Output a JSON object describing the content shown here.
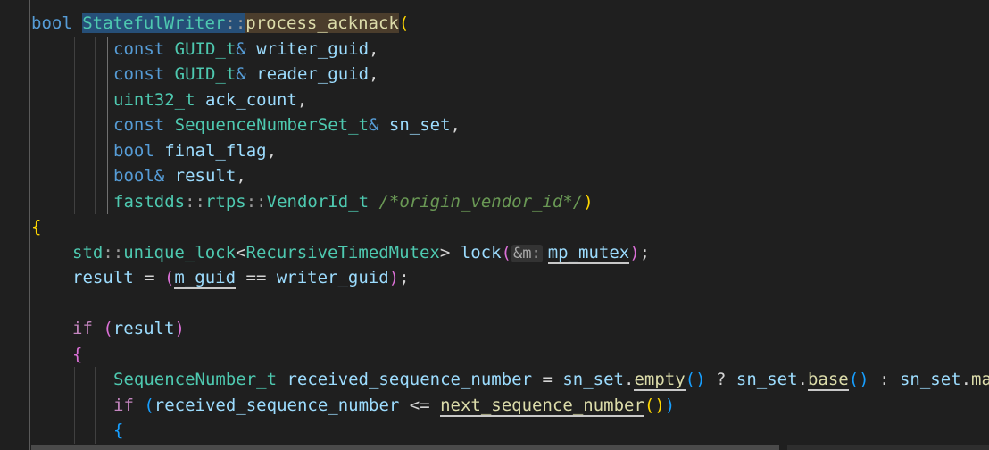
{
  "lines": [
    {
      "indent": 0,
      "tokens": [
        {
          "t": "bool",
          "c": "#569cd6"
        },
        {
          "t": " ",
          "c": "#d4d4d4"
        },
        {
          "t": "StatefulWriter",
          "c": "#4ec9b0",
          "hl": "sel"
        },
        {
          "t": "::",
          "c": "#9a9a9a",
          "hl": "sel"
        },
        {
          "t": "process_acknack",
          "c": "#dcdcaa",
          "hl": "hl"
        },
        {
          "t": "(",
          "c": "#ffd700"
        }
      ]
    },
    {
      "indent": 8,
      "tokens": [
        {
          "t": "const",
          "c": "#569cd6"
        },
        {
          "t": " ",
          "c": "#d4d4d4"
        },
        {
          "t": "GUID_t",
          "c": "#4ec9b0"
        },
        {
          "t": "&",
          "c": "#569cd6"
        },
        {
          "t": " ",
          "c": "#d4d4d4"
        },
        {
          "t": "writer_guid",
          "c": "#9cdcfe"
        },
        {
          "t": ",",
          "c": "#d4d4d4"
        }
      ]
    },
    {
      "indent": 8,
      "tokens": [
        {
          "t": "const",
          "c": "#569cd6"
        },
        {
          "t": " ",
          "c": "#d4d4d4"
        },
        {
          "t": "GUID_t",
          "c": "#4ec9b0"
        },
        {
          "t": "&",
          "c": "#569cd6"
        },
        {
          "t": " ",
          "c": "#d4d4d4"
        },
        {
          "t": "reader_guid",
          "c": "#9cdcfe"
        },
        {
          "t": ",",
          "c": "#d4d4d4"
        }
      ]
    },
    {
      "indent": 8,
      "tokens": [
        {
          "t": "uint32_t",
          "c": "#4ec9b0"
        },
        {
          "t": " ",
          "c": "#d4d4d4"
        },
        {
          "t": "ack_count",
          "c": "#9cdcfe"
        },
        {
          "t": ",",
          "c": "#d4d4d4"
        }
      ]
    },
    {
      "indent": 8,
      "tokens": [
        {
          "t": "const",
          "c": "#569cd6"
        },
        {
          "t": " ",
          "c": "#d4d4d4"
        },
        {
          "t": "SequenceNumberSet_t",
          "c": "#4ec9b0"
        },
        {
          "t": "&",
          "c": "#569cd6"
        },
        {
          "t": " ",
          "c": "#d4d4d4"
        },
        {
          "t": "sn_set",
          "c": "#9cdcfe"
        },
        {
          "t": ",",
          "c": "#d4d4d4"
        }
      ]
    },
    {
      "indent": 8,
      "tokens": [
        {
          "t": "bool",
          "c": "#569cd6"
        },
        {
          "t": " ",
          "c": "#d4d4d4"
        },
        {
          "t": "final_flag",
          "c": "#9cdcfe"
        },
        {
          "t": ",",
          "c": "#d4d4d4"
        }
      ]
    },
    {
      "indent": 8,
      "tokens": [
        {
          "t": "bool",
          "c": "#569cd6"
        },
        {
          "t": "&",
          "c": "#569cd6"
        },
        {
          "t": " ",
          "c": "#d4d4d4"
        },
        {
          "t": "result",
          "c": "#9cdcfe"
        },
        {
          "t": ",",
          "c": "#d4d4d4"
        }
      ]
    },
    {
      "indent": 8,
      "tokens": [
        {
          "t": "fastdds",
          "c": "#4ec9b0"
        },
        {
          "t": "::",
          "c": "#9a9a9a"
        },
        {
          "t": "rtps",
          "c": "#4ec9b0"
        },
        {
          "t": "::",
          "c": "#9a9a9a"
        },
        {
          "t": "VendorId_t",
          "c": "#4ec9b0"
        },
        {
          "t": " ",
          "c": "#d4d4d4"
        },
        {
          "t": "/*origin_vendor_id*/",
          "c": "#6a9955",
          "i": true
        },
        {
          "t": ")",
          "c": "#ffd700"
        }
      ]
    },
    {
      "indent": 0,
      "tokens": [
        {
          "t": "{",
          "c": "#ffd700"
        }
      ]
    },
    {
      "indent": 4,
      "tokens": [
        {
          "t": "std",
          "c": "#4ec9b0"
        },
        {
          "t": "::",
          "c": "#9a9a9a"
        },
        {
          "t": "unique_lock",
          "c": "#4ec9b0"
        },
        {
          "t": "<",
          "c": "#d4d4d4"
        },
        {
          "t": "RecursiveTimedMutex",
          "c": "#4ec9b0"
        },
        {
          "t": ">",
          "c": "#d4d4d4"
        },
        {
          "t": " ",
          "c": "#d4d4d4"
        },
        {
          "t": "lock",
          "c": "#9cdcfe"
        },
        {
          "t": "(",
          "c": "#da70d6"
        },
        {
          "t": "&m:",
          "hint": true
        },
        {
          "t": "mp_mutex",
          "c": "#9cdcfe",
          "ul": true
        },
        {
          "t": ")",
          "c": "#da70d6"
        },
        {
          "t": ";",
          "c": "#d4d4d4"
        }
      ]
    },
    {
      "indent": 4,
      "tokens": [
        {
          "t": "result",
          "c": "#9cdcfe"
        },
        {
          "t": " = ",
          "c": "#d4d4d4"
        },
        {
          "t": "(",
          "c": "#da70d6"
        },
        {
          "t": "m_guid",
          "c": "#9cdcfe",
          "ul": true
        },
        {
          "t": " == ",
          "c": "#d4d4d4"
        },
        {
          "t": "writer_guid",
          "c": "#9cdcfe"
        },
        {
          "t": ")",
          "c": "#da70d6"
        },
        {
          "t": ";",
          "c": "#d4d4d4"
        }
      ]
    },
    {
      "indent": 0,
      "tokens": []
    },
    {
      "indent": 4,
      "tokens": [
        {
          "t": "if",
          "c": "#c586c0"
        },
        {
          "t": " ",
          "c": "#d4d4d4"
        },
        {
          "t": "(",
          "c": "#da70d6"
        },
        {
          "t": "result",
          "c": "#9cdcfe"
        },
        {
          "t": ")",
          "c": "#da70d6"
        }
      ]
    },
    {
      "indent": 4,
      "tokens": [
        {
          "t": "{",
          "c": "#da70d6"
        }
      ]
    },
    {
      "indent": 8,
      "tokens": [
        {
          "t": "SequenceNumber_t",
          "c": "#4ec9b0"
        },
        {
          "t": " ",
          "c": "#d4d4d4"
        },
        {
          "t": "received_sequence_number",
          "c": "#9cdcfe"
        },
        {
          "t": " = ",
          "c": "#d4d4d4"
        },
        {
          "t": "sn_set",
          "c": "#9cdcfe"
        },
        {
          "t": ".",
          "c": "#d4d4d4"
        },
        {
          "t": "empty",
          "c": "#dcdcaa",
          "ul": true
        },
        {
          "t": "()",
          "c": "#179fff"
        },
        {
          "t": " ? ",
          "c": "#d4d4d4"
        },
        {
          "t": "sn_set",
          "c": "#9cdcfe"
        },
        {
          "t": ".",
          "c": "#d4d4d4"
        },
        {
          "t": "base",
          "c": "#dcdcaa",
          "ul": true
        },
        {
          "t": "()",
          "c": "#179fff"
        },
        {
          "t": " : ",
          "c": "#d4d4d4"
        },
        {
          "t": "sn_set",
          "c": "#9cdcfe"
        },
        {
          "t": ".",
          "c": "#d4d4d4"
        },
        {
          "t": "max",
          "c": "#dcdcaa"
        },
        {
          "t": "()",
          "c": "#179fff"
        },
        {
          "t": ";",
          "c": "#d4d4d4"
        }
      ]
    },
    {
      "indent": 8,
      "tokens": [
        {
          "t": "if",
          "c": "#c586c0"
        },
        {
          "t": " ",
          "c": "#d4d4d4"
        },
        {
          "t": "(",
          "c": "#179fff"
        },
        {
          "t": "received_sequence_number",
          "c": "#9cdcfe"
        },
        {
          "t": " <= ",
          "c": "#d4d4d4"
        },
        {
          "t": "next_sequence_number",
          "c": "#dcdcaa",
          "ul": true
        },
        {
          "t": "()",
          "c": "#ffd700"
        },
        {
          "t": ")",
          "c": "#179fff"
        }
      ]
    },
    {
      "indent": 8,
      "tokens": [
        {
          "t": "{",
          "c": "#179fff"
        }
      ]
    }
  ]
}
